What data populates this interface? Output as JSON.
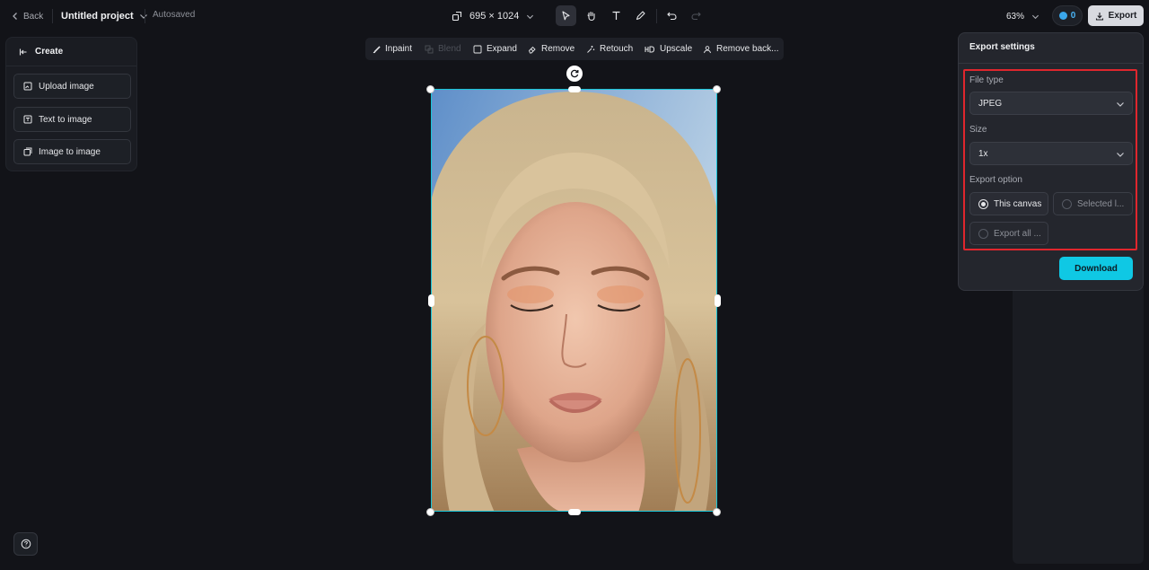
{
  "topbar": {
    "back_label": "Back",
    "project_title": "Untitled project",
    "autosaved": "Autosaved",
    "canvas_size": "695 × 1024",
    "zoom": "63%",
    "credits": "0",
    "export_label": "Export"
  },
  "create_panel": {
    "title": "Create",
    "items": [
      {
        "label": "Upload image",
        "icon": "upload-image-icon"
      },
      {
        "label": "Text to image",
        "icon": "text-to-image-icon"
      },
      {
        "label": "Image to image",
        "icon": "image-to-image-icon"
      }
    ]
  },
  "edit_toolbar": {
    "items": [
      {
        "label": "Inpaint",
        "icon": "brush-icon",
        "enabled": true
      },
      {
        "label": "Blend",
        "icon": "blend-icon",
        "enabled": false
      },
      {
        "label": "Expand",
        "icon": "expand-icon",
        "enabled": true
      },
      {
        "label": "Remove",
        "icon": "eraser-icon",
        "enabled": true
      },
      {
        "label": "Retouch",
        "icon": "sparkle-icon",
        "enabled": true
      },
      {
        "label": "Upscale",
        "icon": "hd-icon",
        "enabled": true
      },
      {
        "label": "Remove back...",
        "icon": "remove-background-icon",
        "enabled": true
      }
    ]
  },
  "export_settings": {
    "title": "Export settings",
    "file_type_label": "File type",
    "file_type_value": "JPEG",
    "size_label": "Size",
    "size_value": "1x",
    "export_option_label": "Export option",
    "options": [
      {
        "label": "This canvas",
        "selected": true
      },
      {
        "label": "Selected l...",
        "selected": false
      },
      {
        "label": "Export all ...",
        "selected": false
      }
    ],
    "download_label": "Download"
  },
  "colors": {
    "accent": "#0fc8e4",
    "selection_border": "#19c5d8",
    "highlight_box": "#e0262d",
    "background": "#121318"
  }
}
